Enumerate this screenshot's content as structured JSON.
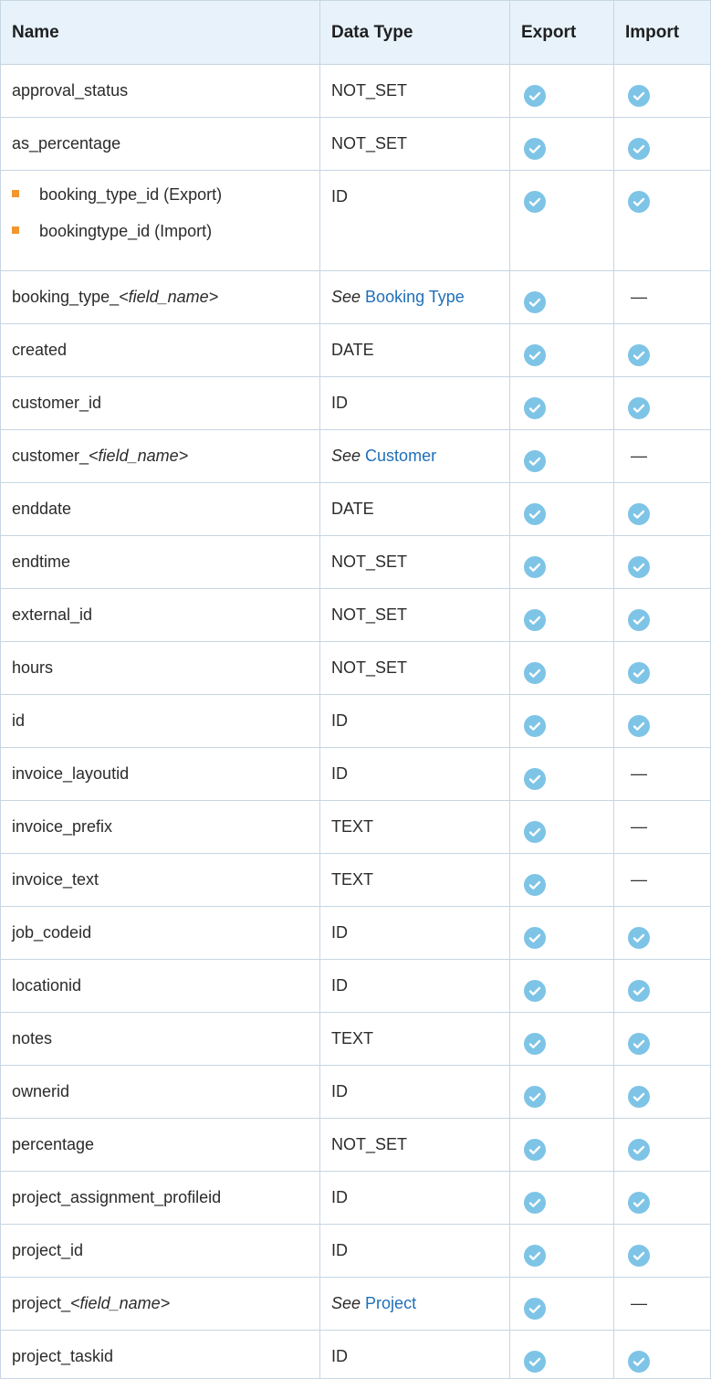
{
  "headers": {
    "name": "Name",
    "data_type": "Data Type",
    "export": "Export",
    "import": "Import"
  },
  "booking_type_row": {
    "item1": "booking_type_id (Export)",
    "item2": "bookingtype_id (Import)",
    "type": "ID"
  },
  "see_label": "See",
  "rows": [
    {
      "name": "approval_status",
      "type": "NOT_SET"
    },
    {
      "name": "as_percentage",
      "type": "NOT_SET"
    },
    {
      "name_prefix": "booking_type_",
      "name_field": "<field_name>",
      "name_suffix": ">",
      "see_link": "Booking Type"
    },
    {
      "name": "created",
      "type": "DATE"
    },
    {
      "name": "customer_id",
      "type": "ID"
    },
    {
      "name_prefix": "customer_",
      "name_field": "<field_name>",
      "see_link": "Customer"
    },
    {
      "name": "enddate",
      "type": "DATE"
    },
    {
      "name": "endtime",
      "type": "NOT_SET"
    },
    {
      "name": "external_id",
      "type": "NOT_SET"
    },
    {
      "name": "hours",
      "type": "NOT_SET"
    },
    {
      "name": "id",
      "type": "ID"
    },
    {
      "name": "invoice_layoutid",
      "type": "ID"
    },
    {
      "name": "invoice_prefix",
      "type": "TEXT"
    },
    {
      "name": "invoice_text",
      "type": "TEXT"
    },
    {
      "name": "job_codeid",
      "type": "ID"
    },
    {
      "name": "locationid",
      "type": "ID"
    },
    {
      "name": "notes",
      "type": "TEXT"
    },
    {
      "name": "ownerid",
      "type": "ID"
    },
    {
      "name": "percentage",
      "type": "NOT_SET"
    },
    {
      "name": "project_assignment_profileid",
      "type": "ID"
    },
    {
      "name": "project_id",
      "type": "ID"
    },
    {
      "name_prefix": "project_",
      "name_field": "<field_name>",
      "see_link": "Project"
    },
    {
      "name": "project_taskid",
      "type": "ID"
    }
  ],
  "dash": "—",
  "colors": {
    "header_bg": "#e7f2fa",
    "check": "#7ec4e6",
    "bullet": "#f2962f",
    "link": "#1f6fb8"
  },
  "icons": {
    "yes": "check-circle-icon"
  }
}
